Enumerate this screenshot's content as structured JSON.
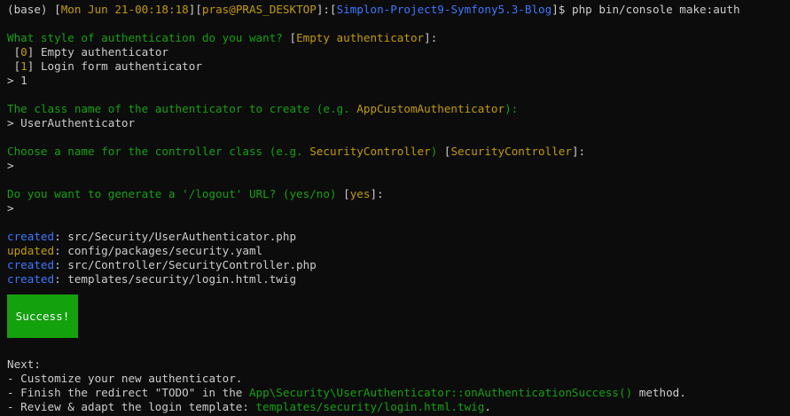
{
  "colors": {
    "background": "#0c0c0c",
    "text": "#cccccc",
    "yellow": "#c19c00",
    "blue": "#3b78ff",
    "green": "#13a10e",
    "success_bg": "#13a10e",
    "success_text": "#f2f2f2"
  },
  "prompt": {
    "env": "(base)",
    "bracket_open": "[",
    "datetime": "Mon Jun 21-00:18:18",
    "bracket_close_open": "][",
    "user_host": "pras@PRAS_DESKTOP",
    "sep": "]:[",
    "project": "Simplon-Project9-Symfony5.3-Blog",
    "end": "]$",
    "command": "php bin/console make:auth"
  },
  "q1": {
    "question": "What style of authentication do you want?",
    "default_open": "[",
    "default": "Empty authenticator",
    "default_close": "]:",
    "options": [
      {
        "index": "0",
        "label": "Empty authenticator"
      },
      {
        "index": "1",
        "label": "Login form authenticator"
      }
    ],
    "answer": "> 1"
  },
  "q2": {
    "question_before": "The class name of the authenticator to create (e.g. ",
    "example": "AppCustomAuthenticator",
    "question_after": "):",
    "answer": "> UserAuthenticator"
  },
  "q3": {
    "question_before": "Choose a name for the controller class (e.g. ",
    "example": "SecurityController",
    "question_after": ")",
    "default_open": "[",
    "default": "SecurityController",
    "default_close": "]:",
    "answer": ">"
  },
  "q4": {
    "question": "Do you want to generate a '/logout' URL? (yes/no)",
    "default_open": "[",
    "default": "yes",
    "default_close": "]:",
    "answer": ">"
  },
  "files": [
    {
      "status": "created",
      "path": ": src/Security/UserAuthenticator.php"
    },
    {
      "status": "updated",
      "path": ": config/packages/security.yaml"
    },
    {
      "status": "created",
      "path": ": src/Controller/SecurityController.php"
    },
    {
      "status": "created",
      "path": ": templates/security/login.html.twig"
    }
  ],
  "success_label": "Success!",
  "next": {
    "title": "Next:",
    "step1": "- Customize your new authenticator.",
    "step2_before": "- Finish the redirect \"TODO\" in the ",
    "step2_code": "App\\Security\\UserAuthenticator::onAuthenticationSuccess()",
    "step2_after": " method.",
    "step3_before": "- Review & adapt the login template: ",
    "step3_code": "templates/security/login.html.twig",
    "step3_after": "."
  }
}
